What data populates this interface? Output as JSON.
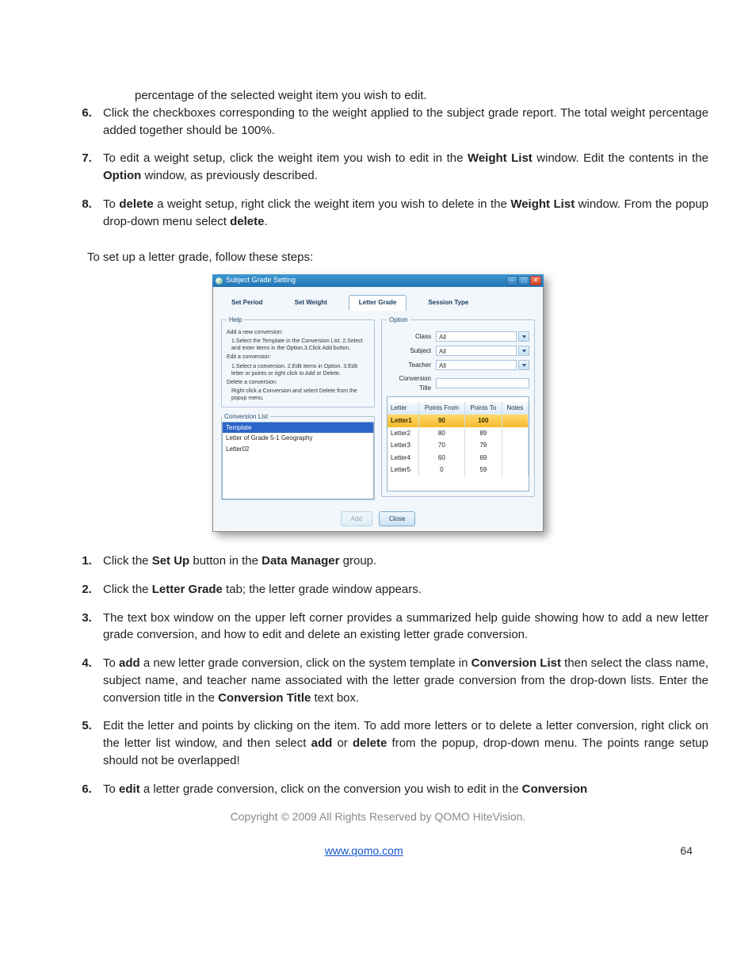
{
  "pre_list_fragment": "percentage of the selected weight item you wish to edit.",
  "first_list": [
    {
      "n": 6,
      "parts": [
        "Click the checkboxes corresponding to the weight applied to the subject grade report. The total weight percentage added together should be 100%."
      ]
    },
    {
      "n": 7,
      "parts": [
        "To edit a weight setup, click the weight item you wish to edit in the ",
        "<b>Weight List</b>",
        " window. Edit the contents in the ",
        "<b>Option</b>",
        " window, as previously described."
      ]
    },
    {
      "n": 8,
      "parts": [
        "To ",
        "<b>delete</b>",
        " a weight setup, right click the weight item you wish to delete in the ",
        "<b>Weight List</b>",
        " window. From the popup drop-down menu select ",
        "<b>delete</b>",
        "."
      ]
    }
  ],
  "intro_line": "To set up a letter grade, follow these steps:",
  "dialog": {
    "title": "Subject Grade Setting",
    "tabs": [
      "Set Period",
      "Set Weight",
      "Letter Grade",
      "Session Type"
    ],
    "active_tab": 2,
    "help": {
      "legend": "Help",
      "items": [
        {
          "title": "Add a new conversion:",
          "body": "1.Select the Template in the Conversion List. 2.Select and enter items in the Option.3.Click Add button."
        },
        {
          "title": "Edit a conversion:",
          "body": "1.Select a conversion. 2.Edit items in Option. 3.Edit letter or points or right click to Add or Delete."
        },
        {
          "title": "Delete a conversion:",
          "body": "Right click a Conversion and select Delete from the popup menu."
        }
      ]
    },
    "conv_legend": "Conversion List",
    "conv_items": [
      {
        "label": "Template",
        "sel": true
      },
      {
        "label": "Letter of Grade 5-1 Geography",
        "sel": false
      },
      {
        "label": "Letter02",
        "sel": false
      }
    ],
    "option_legend": "Option",
    "fields": [
      {
        "label": "Class",
        "value": "All",
        "dd": true
      },
      {
        "label": "Subject",
        "value": "All",
        "dd": true
      },
      {
        "label": "Teacher",
        "value": "All",
        "dd": true
      },
      {
        "label": "Conversion Title",
        "value": "",
        "dd": false
      }
    ],
    "letter_headers": [
      "Letter",
      "Points From",
      "Points To",
      "Notes"
    ],
    "letter_rows": [
      {
        "cells": [
          "Letter1",
          "90",
          "100",
          ""
        ],
        "sel": true
      },
      {
        "cells": [
          "Letter2",
          "80",
          "89",
          ""
        ],
        "sel": false
      },
      {
        "cells": [
          "Letter3",
          "70",
          "79",
          ""
        ],
        "sel": false
      },
      {
        "cells": [
          "Letter4",
          "60",
          "69",
          ""
        ],
        "sel": false
      },
      {
        "cells": [
          "Letter5",
          "0",
          "59",
          ""
        ],
        "sel": false
      }
    ],
    "buttons": {
      "add": "Add",
      "close": "Close"
    }
  },
  "second_list": [
    {
      "n": 1,
      "parts": [
        "Click the ",
        "<b>Set Up</b>",
        " button in the ",
        "<b>Data Manager</b>",
        " group."
      ]
    },
    {
      "n": 2,
      "parts": [
        "Click the ",
        "<b>Letter Grade</b>",
        " tab; the letter grade window appears."
      ]
    },
    {
      "n": 3,
      "parts": [
        "The text box window on the upper left corner provides a summarized help guide showing how to add a new letter grade conversion, and how to edit and delete an existing letter grade conversion."
      ]
    },
    {
      "n": 4,
      "parts": [
        "To ",
        "<b>add</b>",
        " a new letter grade conversion, click on the system template in ",
        "<b>Conversion List</b>",
        " then select the class name, subject name, and teacher name associated with the letter grade conversion from the drop-down lists. Enter the conversion title in the ",
        "<b>Conversion Title</b>",
        " text box."
      ]
    },
    {
      "n": 5,
      "parts": [
        "Edit the letter and points by clicking on the item. To add more letters or to delete a letter conversion, right click on the letter list window, and then select ",
        "<b>add</b>",
        " or ",
        "<b>delete</b>",
        " from the popup, drop-down menu. The points range setup should not be overlapped!"
      ]
    },
    {
      "n": 6,
      "parts": [
        "To ",
        "<b>edit</b>",
        " a letter grade conversion, click on the conversion you wish to edit in the ",
        "<b>Conversion</b>"
      ]
    }
  ],
  "copyright": "Copyright © 2009 All Rights Reserved by QOMO HiteVision.",
  "url": "www.qomo.com",
  "page_num": "64"
}
